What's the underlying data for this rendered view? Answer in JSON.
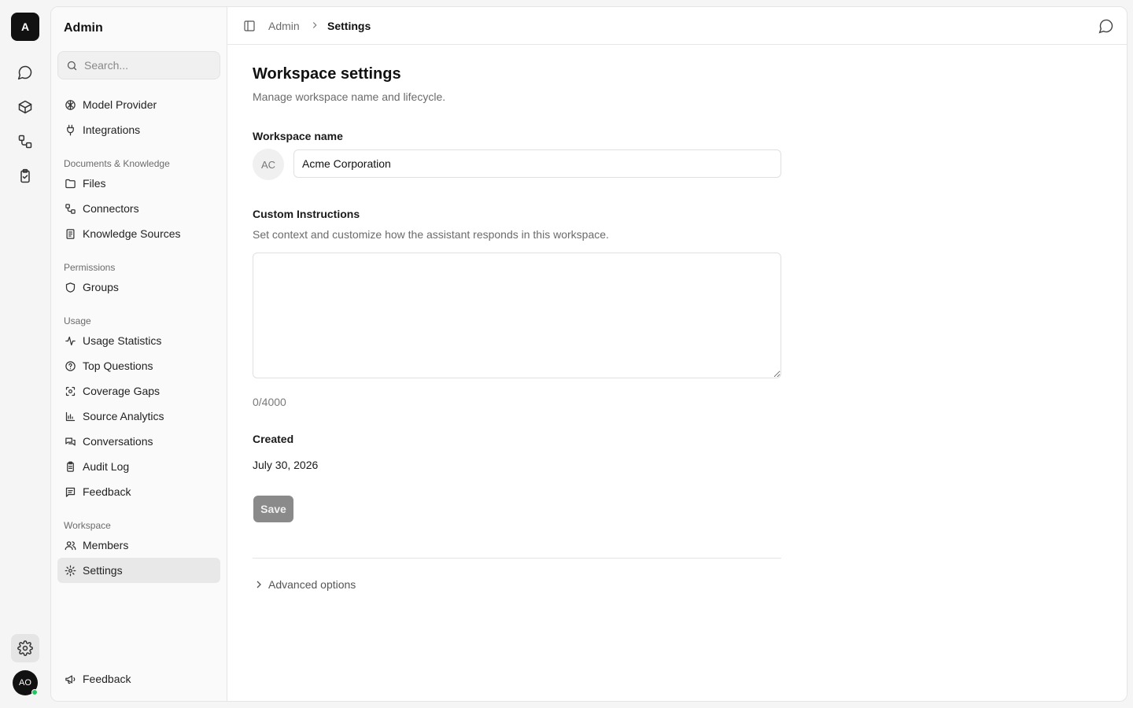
{
  "rail": {
    "logo": "A",
    "avatar": "AO"
  },
  "sidebar": {
    "title": "Admin",
    "search_placeholder": "Search...",
    "top_items": [
      {
        "label": "Model Provider",
        "icon": "brain-icon"
      },
      {
        "label": "Integrations",
        "icon": "plug-icon"
      }
    ],
    "sections": [
      {
        "title": "Documents & Knowledge",
        "items": [
          {
            "label": "Files",
            "icon": "folder-icon"
          },
          {
            "label": "Connectors",
            "icon": "connector-icon"
          },
          {
            "label": "Knowledge Sources",
            "icon": "book-icon"
          }
        ]
      },
      {
        "title": "Permissions",
        "items": [
          {
            "label": "Groups",
            "icon": "shield-icon"
          }
        ]
      },
      {
        "title": "Usage",
        "items": [
          {
            "label": "Usage Statistics",
            "icon": "activity-icon"
          },
          {
            "label": "Top Questions",
            "icon": "help-circle-icon"
          },
          {
            "label": "Coverage Gaps",
            "icon": "scan-icon"
          },
          {
            "label": "Source Analytics",
            "icon": "bar-chart-icon"
          },
          {
            "label": "Conversations",
            "icon": "messages-icon"
          },
          {
            "label": "Audit Log",
            "icon": "clipboard-icon"
          },
          {
            "label": "Feedback",
            "icon": "message-square-text-icon"
          }
        ]
      },
      {
        "title": "Workspace",
        "items": [
          {
            "label": "Members",
            "icon": "users-icon"
          },
          {
            "label": "Settings",
            "icon": "gear-icon",
            "active": true
          }
        ]
      }
    ],
    "footer_item": {
      "label": "Feedback",
      "icon": "megaphone-icon"
    }
  },
  "topbar": {
    "breadcrumb": [
      "Admin",
      "Settings"
    ]
  },
  "main": {
    "title": "Workspace settings",
    "subtitle": "Manage workspace name and lifecycle.",
    "workspace_name_label": "Workspace name",
    "workspace_avatar": "AC",
    "workspace_name_value": "Acme Corporation",
    "custom_instructions_label": "Custom Instructions",
    "custom_instructions_desc": "Set context and customize how the assistant responds in this workspace.",
    "custom_instructions_value": "",
    "char_counter": "0/4000",
    "created_label": "Created",
    "created_value": "July 30, 2026",
    "save_label": "Save",
    "advanced_label": "Advanced options"
  },
  "colors": {
    "accent_dark": "#111111",
    "save_disabled": "#8a8a8a",
    "online": "#22c55e"
  }
}
